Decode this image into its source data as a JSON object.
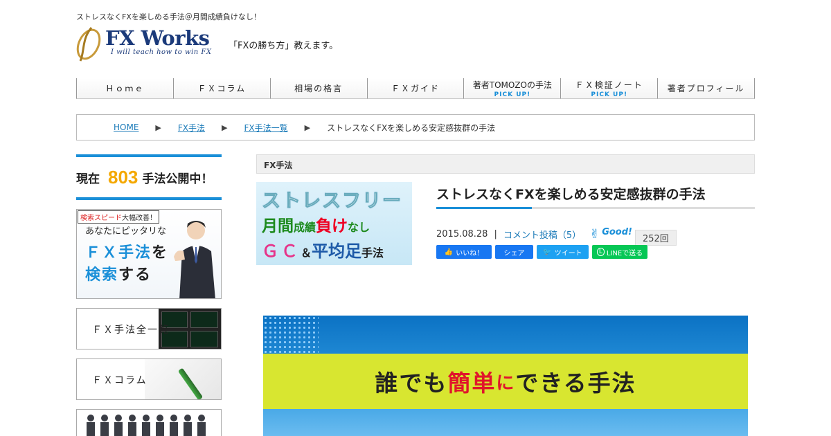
{
  "header": {
    "tagline": "ストレスなくFXを楽しめる手法＠月間成績負けなし！",
    "logo_title": "FX Works",
    "logo_sub": "I will teach how to win FX",
    "catch": "「FXの勝ち方」教えます。"
  },
  "gnav": [
    {
      "label": "Ｈｏｍｅ",
      "pick": ""
    },
    {
      "label": "ＦＸコラム",
      "pick": ""
    },
    {
      "label": "相場の格言",
      "pick": ""
    },
    {
      "label": "ＦＸガイド",
      "pick": ""
    },
    {
      "label": "著者TOMOZOの手法",
      "pick": "PICK UP!"
    },
    {
      "label": "ＦＸ検証ノート",
      "pick": "PICK UP!"
    },
    {
      "label": "著者プロフィール",
      "pick": ""
    }
  ],
  "breadcrumb": {
    "items": [
      "HOME",
      "FX手法",
      "FX手法一覧"
    ],
    "separator": "▶",
    "current": "ストレスなくFXを楽しめる安定感抜群の手法"
  },
  "sidebar": {
    "counter_prefix": "現在",
    "counter_num": "803",
    "counter_suffix": "手法公開中！",
    "search_badge_red": "検索スピード",
    "search_badge_rest": "大幅改善！",
    "search_line1": "あなたにピッタリな",
    "search_line2_a": "ＦＸ手法",
    "search_line2_b": "を",
    "search_line3_a": "検索",
    "search_line3_b": "する",
    "list_label": "ＦＸ手法全一覧",
    "column_label": "ＦＸコラム"
  },
  "article": {
    "category": "FX手法",
    "thumb_line1": "ストレスフリー",
    "thumb_line2_a": "月間",
    "thumb_line2_b": "成績",
    "thumb_line2_c": "負け",
    "thumb_line2_d": "なし",
    "thumb_line3_a": "ＧＣ",
    "thumb_line3_b": "＆",
    "thumb_line3_c": "平均足",
    "thumb_line3_d": "手法",
    "title": "ストレスなくFXを楽しめる安定感抜群の手法",
    "date": "2015.08.28",
    "comments": "コメント投稿（5）",
    "good_label": "Good!",
    "good_count": "252回",
    "share_like": "いいね！",
    "share_share": "シェア",
    "share_tweet": "ツイート",
    "share_line": "LINEで送る",
    "hero_a": "誰でも",
    "hero_b": "簡単",
    "hero_c": "に",
    "hero_d": "できる手法"
  },
  "colors": {
    "accent": "#1a8fd8",
    "brand_navy": "#1b3a7a",
    "counter_orange": "#f4a800",
    "hero_band": "#d8e630"
  }
}
